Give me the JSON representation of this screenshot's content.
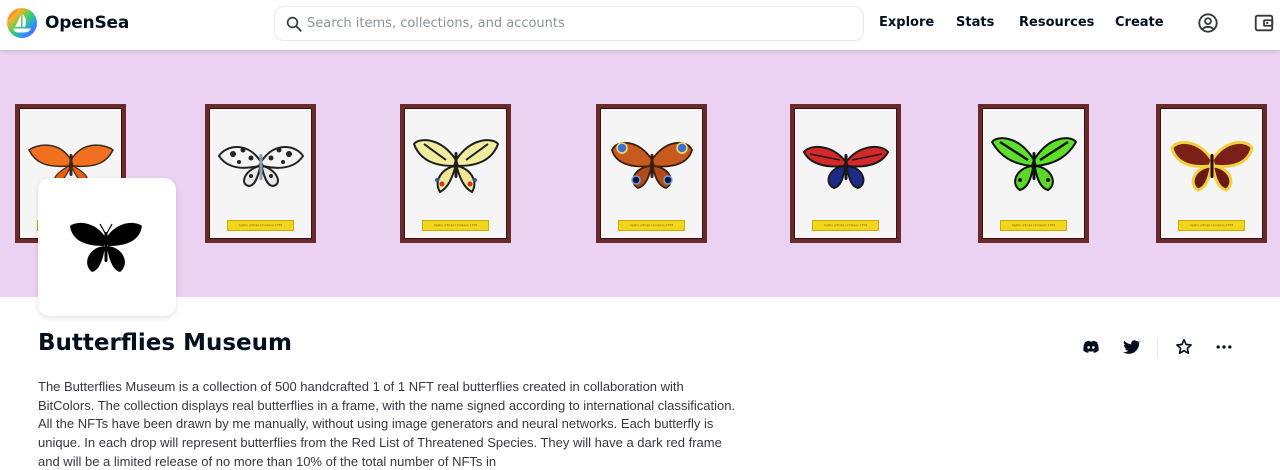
{
  "nav": {
    "brand": "OpenSea",
    "search_placeholder": "Search items, collections, and accounts",
    "links": [
      "Explore",
      "Stats",
      "Resources",
      "Create"
    ],
    "icons": [
      "account-icon",
      "wallet-icon"
    ]
  },
  "banner": {
    "background": "#ecd2f2",
    "frame_color": "#6a2a2a",
    "plate_text": "Aglais urticae Linnaeus 1758",
    "butterflies": [
      {
        "name": "orange-butterfly",
        "colors": [
          "#f07020",
          "#3a2a20"
        ]
      },
      {
        "name": "black-white-butterfly",
        "colors": [
          "#ffffff",
          "#222222"
        ]
      },
      {
        "name": "swallowtail-butterfly",
        "colors": [
          "#f2eca0",
          "#1e1e1e"
        ]
      },
      {
        "name": "peacock-butterfly",
        "colors": [
          "#c85a20",
          "#3a6fd6"
        ]
      },
      {
        "name": "red-blue-butterfly",
        "colors": [
          "#d62828",
          "#1c2a8a"
        ]
      },
      {
        "name": "green-birdwing-butterfly",
        "colors": [
          "#5ee02a",
          "#111111"
        ]
      },
      {
        "name": "mourning-cloak-butterfly",
        "colors": [
          "#7a2018",
          "#f0d040"
        ]
      }
    ]
  },
  "collection": {
    "title": "Butterflies Museum",
    "description": "The Butterflies Museum is a collection of 500 handcrafted 1 of 1 NFT real butterflies created in collaboration with BitColors. The collection displays real butterflies in a frame, with the name signed according to international classification. All the NFTs have been drawn by me manually, without using image generators and neural networks. Each butterfly is unique. In each drop will represent butterflies from the Red List of Threatened Species. They will have a dark red frame and will be a limited release of no more than 10% of the total number of NFTs in",
    "actions": [
      "discord-icon",
      "twitter-icon",
      "star-icon",
      "more-icon"
    ]
  }
}
